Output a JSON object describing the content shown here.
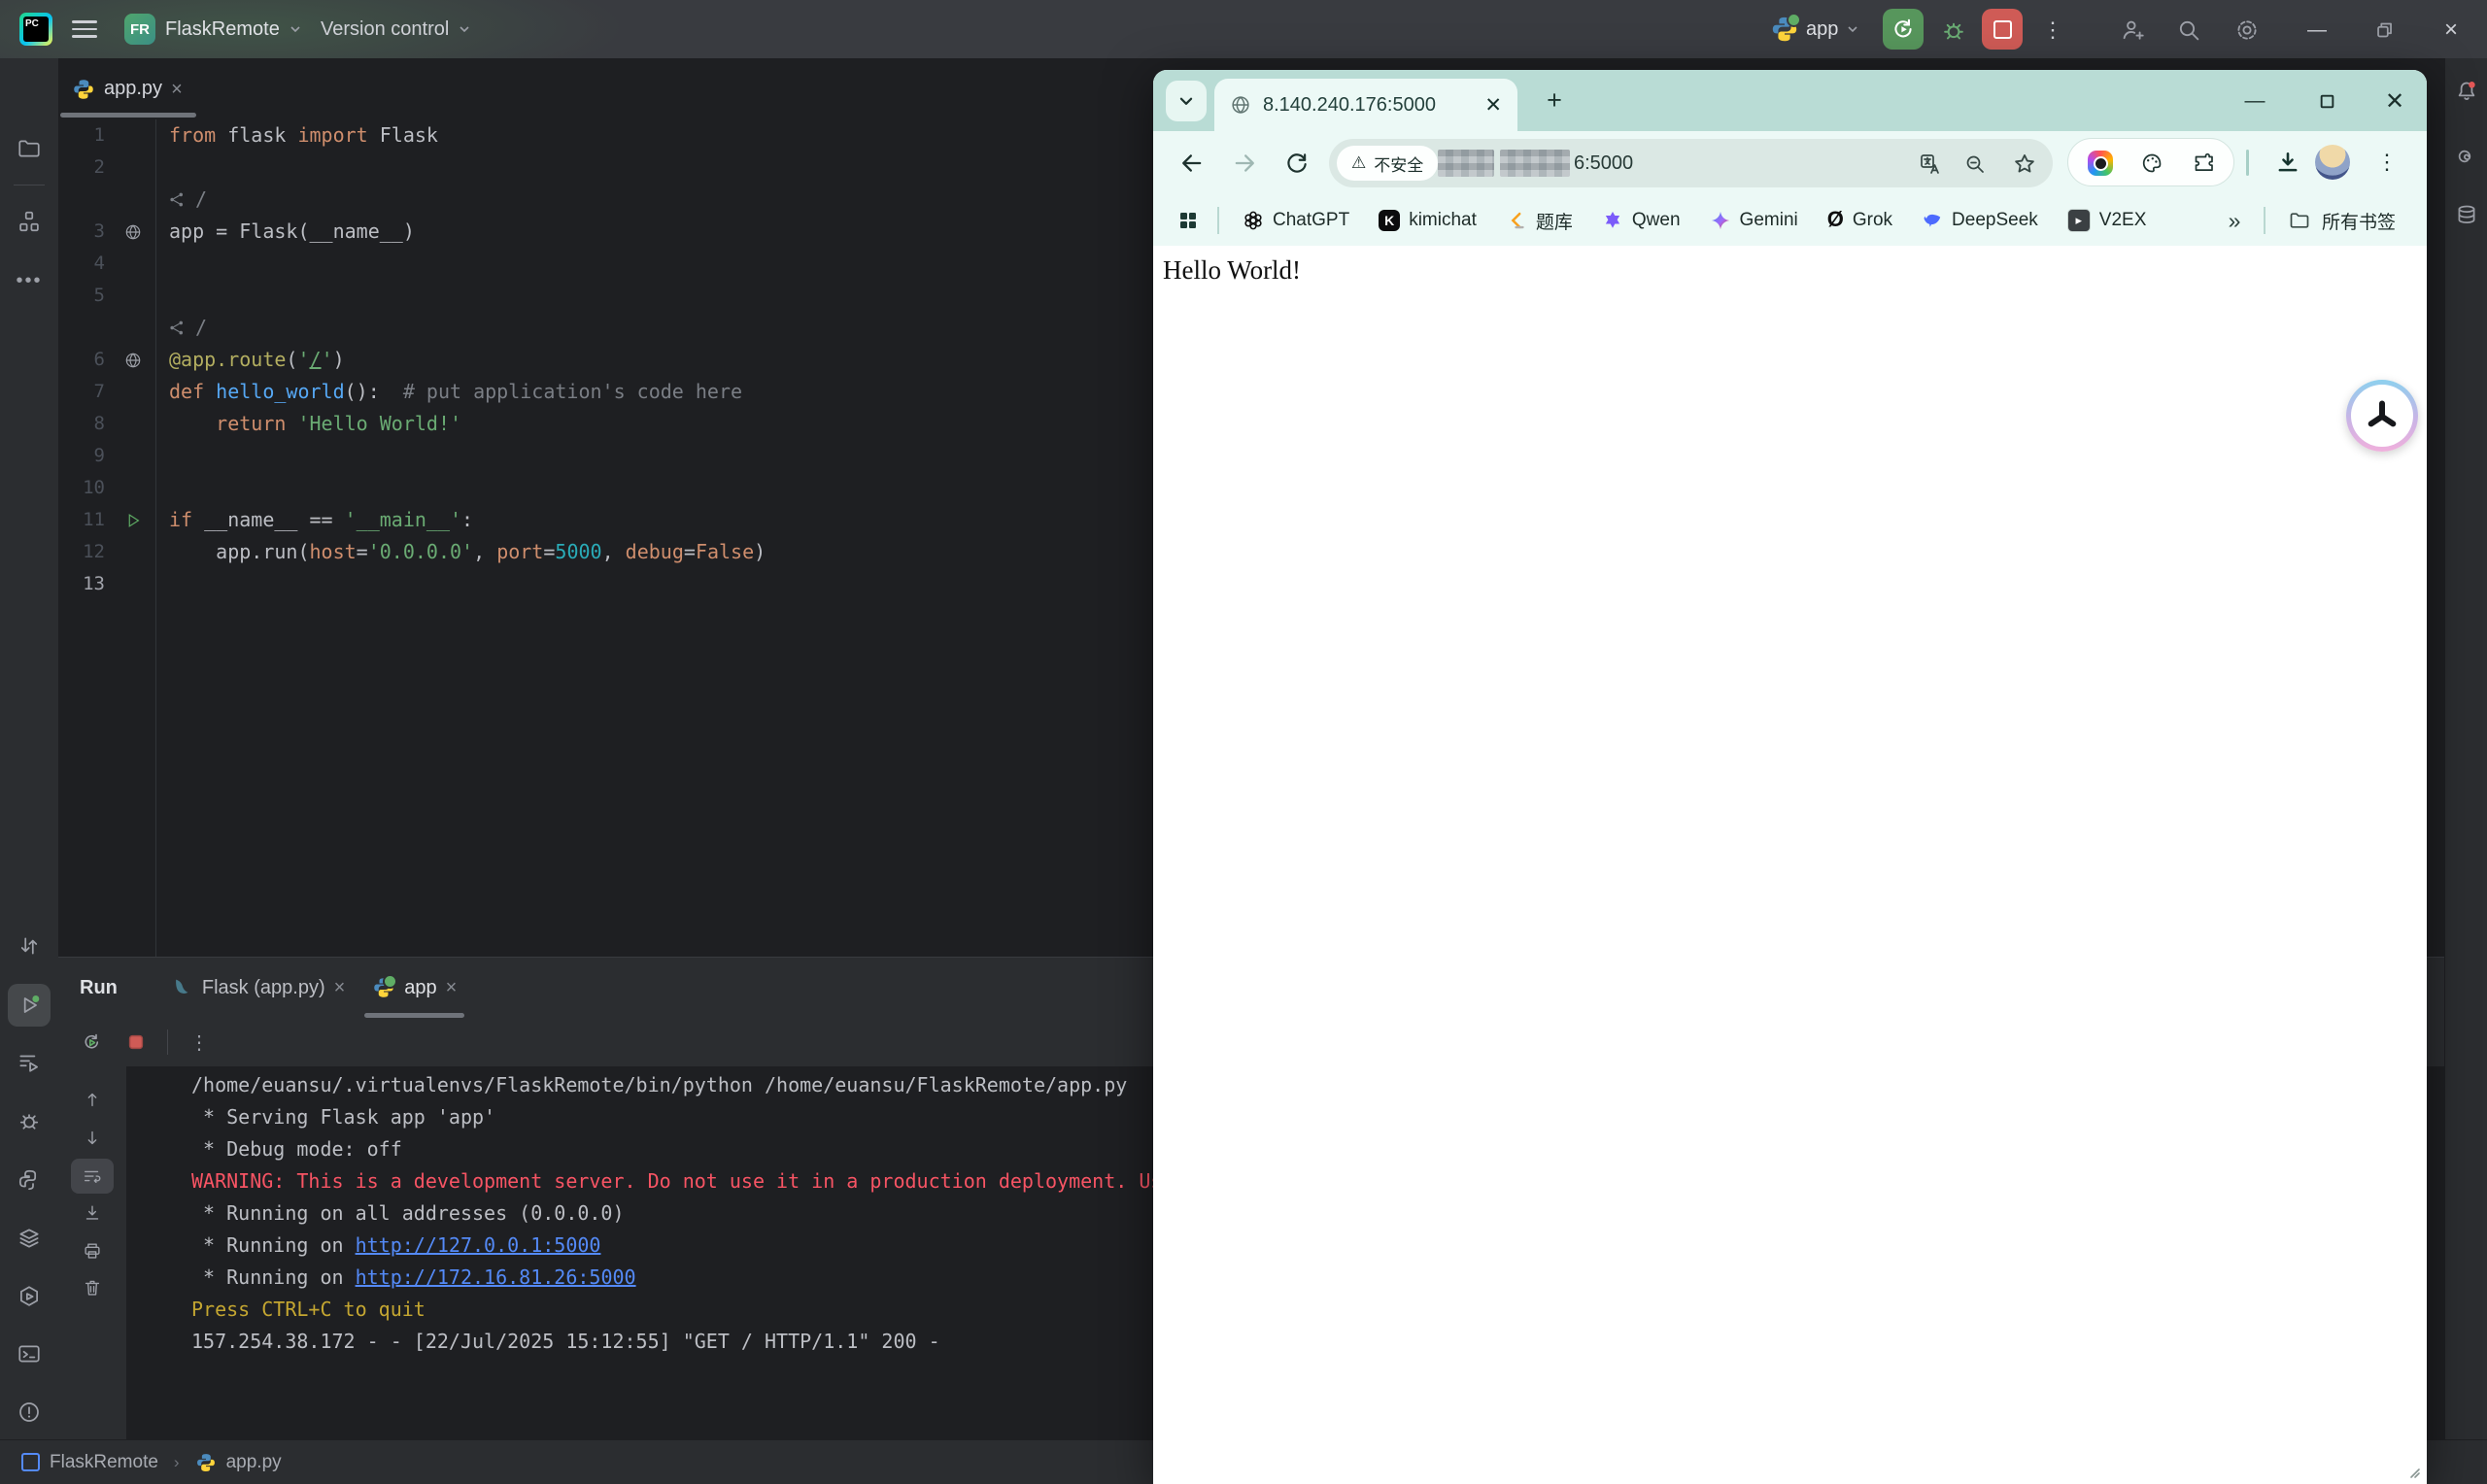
{
  "pycharm": {
    "titlebar": {
      "app_badge": "PC",
      "project_badge": "FR",
      "project_name": "FlaskRemote",
      "vcs_label": "Version control",
      "run_config": "app"
    },
    "editor_tab": "app.py",
    "editor": {
      "lines": [
        {
          "n": "1",
          "segs": [
            {
              "t": "from",
              "c": "kw"
            },
            {
              "t": " flask ",
              "c": "pl"
            },
            {
              "t": "import",
              "c": "kw"
            },
            {
              "t": " Flask",
              "c": "pl"
            }
          ]
        },
        {
          "n": "2",
          "segs": []
        },
        {
          "inlay": true,
          "segs": [
            {
              "t": "/",
              "c": "com"
            }
          ]
        },
        {
          "n": "3",
          "g": "globe",
          "segs": [
            {
              "t": "app = Flask(__name__)",
              "c": "pl"
            }
          ]
        },
        {
          "n": "4",
          "segs": []
        },
        {
          "n": "5",
          "segs": []
        },
        {
          "inlay": true,
          "segs": [
            {
              "t": "/",
              "c": "com"
            }
          ]
        },
        {
          "n": "6",
          "g": "globe",
          "segs": [
            {
              "t": "@app.route",
              "c": "dec"
            },
            {
              "t": "(",
              "c": "pl"
            },
            {
              "t": "'",
              "c": "str"
            },
            {
              "t": "/",
              "c": "strU"
            },
            {
              "t": "'",
              "c": "str"
            },
            {
              "t": ")",
              "c": "pl"
            }
          ]
        },
        {
          "n": "7",
          "segs": [
            {
              "t": "def ",
              "c": "kw"
            },
            {
              "t": "hello_world",
              "c": "fn"
            },
            {
              "t": "():",
              "c": "pl"
            },
            {
              "t": "  # put application's code here",
              "c": "com"
            }
          ]
        },
        {
          "n": "8",
          "segs": [
            {
              "t": "    ",
              "c": "pl"
            },
            {
              "t": "return ",
              "c": "kw"
            },
            {
              "t": "'Hello World!'",
              "c": "str"
            }
          ]
        },
        {
          "n": "9",
          "segs": []
        },
        {
          "n": "10",
          "segs": []
        },
        {
          "n": "11",
          "g": "run",
          "segs": [
            {
              "t": "if ",
              "c": "kw"
            },
            {
              "t": "__name__ == ",
              "c": "pl"
            },
            {
              "t": "'__main__'",
              "c": "str"
            },
            {
              "t": ":",
              "c": "pl"
            }
          ]
        },
        {
          "n": "12",
          "segs": [
            {
              "t": "    app.run(",
              "c": "pl"
            },
            {
              "t": "host",
              "c": "par"
            },
            {
              "t": "=",
              "c": "pl"
            },
            {
              "t": "'0.0.0.0'",
              "c": "str"
            },
            {
              "t": ", ",
              "c": "pl"
            },
            {
              "t": "port",
              "c": "par"
            },
            {
              "t": "=",
              "c": "pl"
            },
            {
              "t": "5000",
              "c": "num"
            },
            {
              "t": ", ",
              "c": "pl"
            },
            {
              "t": "debug",
              "c": "par"
            },
            {
              "t": "=",
              "c": "pl"
            },
            {
              "t": "False",
              "c": "kw"
            },
            {
              "t": ")",
              "c": "pl"
            }
          ]
        },
        {
          "n": "13",
          "cur": true,
          "segs": []
        }
      ]
    },
    "run_panel": {
      "title": "Run",
      "tabs": [
        {
          "label": "Flask (app.py)"
        },
        {
          "label": "app",
          "active": true
        }
      ],
      "console": [
        [
          {
            "t": "/home/euansu/.virtualenvs/FlaskRemote/bin/python /home/euansu/FlaskRemote/app.py",
            "c": "out"
          }
        ],
        [
          {
            "t": " * Serving Flask app 'app'",
            "c": "out"
          }
        ],
        [
          {
            "t": " * Debug mode: off",
            "c": "out"
          }
        ],
        [
          {
            "t": "WARNING: This is a development server. Do not use it in a production deployment. Use a p",
            "c": "warn"
          }
        ],
        [
          {
            "t": " * Running on all addresses (0.0.0.0)",
            "c": "out"
          }
        ],
        [
          {
            "t": " * Running on ",
            "c": "out"
          },
          {
            "t": "http://127.0.0.1:5000",
            "c": "link"
          }
        ],
        [
          {
            "t": " * Running on ",
            "c": "out"
          },
          {
            "t": "http://172.16.81.26:5000",
            "c": "link"
          }
        ],
        [
          {
            "t": "Press CTRL+C to quit",
            "c": "yellow"
          }
        ],
        [
          {
            "t": "157.254.38.172 - - [22/Jul/2025 15:12:55] \"GET / HTTP/1.1\" 200 -",
            "c": "out"
          }
        ]
      ]
    },
    "statusbar": {
      "project": "FlaskRemote",
      "file": "app.py"
    }
  },
  "browser": {
    "tab_title": "8.140.240.176:5000",
    "new_tab_label": "+",
    "security_warning_glyph": "⚠",
    "security_label": "不安全",
    "url_visible_suffix": "6:5000",
    "bookmarks": {
      "items": [
        {
          "label": "ChatGPT",
          "icon": "chatgpt-icon"
        },
        {
          "label": "kimichat",
          "icon": "kimichat-icon"
        },
        {
          "label": "题库",
          "icon": "leetcode-icon"
        },
        {
          "label": "Qwen",
          "icon": "qwen-icon"
        },
        {
          "label": "Gemini",
          "icon": "gemini-icon"
        },
        {
          "label": "Grok",
          "icon": "grok-icon"
        },
        {
          "label": "DeepSeek",
          "icon": "deepseek-icon"
        },
        {
          "label": "V2EX",
          "icon": "v2ex-icon"
        }
      ],
      "overflow_glyph": "»",
      "all_bookmarks_label": "所有书签"
    },
    "page_text": "Hello World!"
  },
  "colors": {
    "accent_green": "#57965c",
    "stop_red": "#cf5b56",
    "warning_red": "#f75464",
    "link_blue": "#548af7",
    "console_yellow": "#c4a631",
    "browser_tabstrip": "#b9dcd5",
    "browser_toolbar": "#ecf9f6",
    "editor_bg": "#1e1f22",
    "panel_bg": "#2b2d30"
  }
}
